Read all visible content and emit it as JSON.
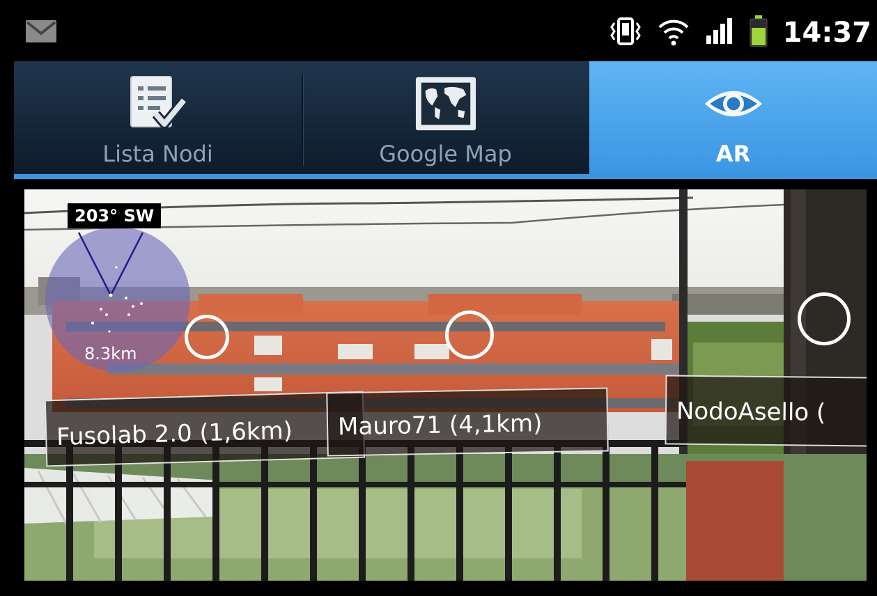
{
  "status_bar": {
    "notification_icon": "gmail-envelope-icon",
    "icons": [
      "vibrate-icon",
      "wifi-icon",
      "signal-icon",
      "battery-icon"
    ],
    "time": "14:37"
  },
  "tabs": [
    {
      "label": "Lista Nodi",
      "icon": "checklist-icon",
      "active": false
    },
    {
      "label": "Google Map",
      "icon": "world-map-icon",
      "active": false
    },
    {
      "label": "AR",
      "icon": "eye-icon",
      "active": true
    }
  ],
  "ar": {
    "heading": "203° SW",
    "radar_distance": "8.3km",
    "pois": [
      {
        "label": "Fusolab 2.0 (1,6km)"
      },
      {
        "label": "Mauro71 (4,1km)"
      },
      {
        "label": "NodoAsello ("
      }
    ]
  },
  "colors": {
    "tab_active": "#3a95e2",
    "tab_bar": "#142538",
    "radar": "#6a68b8"
  }
}
